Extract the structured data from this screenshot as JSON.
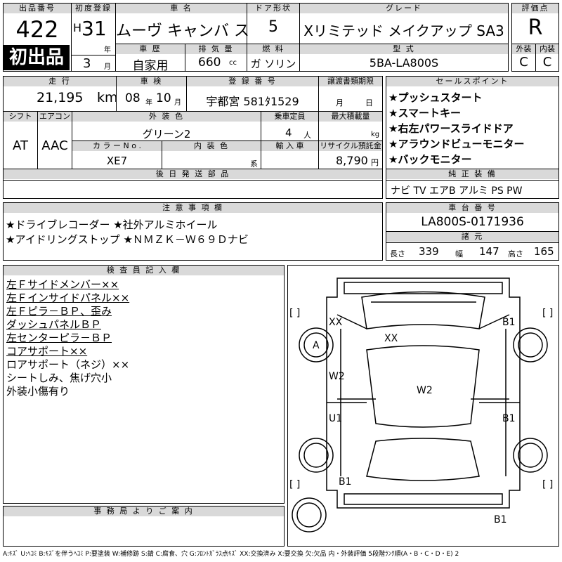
{
  "header": {
    "lot_label": "出品番号",
    "lot_no": "422",
    "first_badge": "初出品",
    "reg_label": "初度登録",
    "era": "H",
    "year": "31",
    "year_unit": "年",
    "month": "3",
    "month_unit": "月",
    "name_label": "車 名",
    "car_name": "ムーヴ キャンバ ス",
    "door_label": "ドア形状",
    "doors": "5",
    "grade_label": "グレード",
    "grade": "Xリミテッド メイクアップ  SA3",
    "score_label": "評価点",
    "score": "R",
    "history_label": "車 歴",
    "history": "自家用",
    "disp_label": "排 気 量",
    "disp": "660",
    "disp_unit": "cc",
    "fuel_label": "燃 料",
    "fuel": "ガ ソリン",
    "model_label": "型 式",
    "model": "5BA-LA800S",
    "ext_label": "外装",
    "ext": "C",
    "int_label": "内装",
    "int": "C"
  },
  "row2": {
    "mileage_label": "走 行",
    "mileage": "21,195",
    "mileage_unit": "km",
    "inspection_label": "車 検",
    "insp_year": "08",
    "insp_year_unit": "年",
    "insp_month": "10",
    "insp_month_unit": "月",
    "plate_label": "登 録 番 号",
    "plate": "宇都宮 581ﾀ1529",
    "transfer_label": "譲渡書類期限",
    "transfer_month": "月",
    "transfer_day": "日",
    "shift_label": "シフト",
    "shift": "AT",
    "ac_label": "エアコン",
    "ac": "AAC",
    "color_label": "外 装 色",
    "color": "グリーン2",
    "capacity_label": "乗車定員",
    "capacity": "4",
    "capacity_unit": "人",
    "load_label": "最大積載量",
    "load_unit": "kg",
    "color_no_label": "カ ラ ー N o .",
    "color_no": "XE7",
    "int_color_label": "内 装 色",
    "int_color_unit": "系",
    "import_label": "輸 入 車",
    "recycle_label": "リサイクル預託金",
    "recycle": "8,790",
    "recycle_unit": "円",
    "later_label": "後 日 発 送 部 品"
  },
  "sales": {
    "label": "セールスポイント",
    "points": [
      "★プッシュスタート",
      "★スマートキー",
      "★右左パワースライドドア",
      "★アラウンドビューモニター",
      "★バックモニター"
    ]
  },
  "equipment": {
    "label": "純 正 装 備",
    "value": "ナビ  TV  エアB  アルミ  PS  PW"
  },
  "caution": {
    "label": "注 意 事 項 欄",
    "lines": [
      "★ドライブレコーダー  ★社外アルミホイール",
      "★アイドリングストップ  ★ＮＭＺＫ－Ｗ６９Ｄナビ"
    ]
  },
  "chassis": {
    "label": "車 台 番 号",
    "value": "LA800S-0171936",
    "spec_label": "諸 元",
    "length_label": "長さ",
    "length": "339",
    "width_label": "幅",
    "width": "147",
    "height_label": "高さ",
    "height": "165"
  },
  "inspector": {
    "label": "検 査 員 記 入 欄",
    "lines": [
      "左Ｆサイドメンバー××",
      "左Ｆインサイドパネル××",
      "左Ｆピラ－ＢＰ、歪み",
      "ダッシュパネルＢＰ",
      "左センターピラ－ＢＰ",
      "コアサポート××",
      "ロアサポート（ネジ）××",
      "シートしみ、焦げ穴小",
      "外装小傷有り"
    ]
  },
  "office": {
    "label": "事 務 局 よ り ご 案 内"
  },
  "diagram": {
    "marks": {
      "front_left": "XX",
      "hood": "XX",
      "front_right": "B1",
      "front_left_wheel": "A",
      "left_front_door": "W2",
      "roof": "W2",
      "left_rear_door": "U1",
      "right_rear_door": "B1",
      "rear_left": "B1",
      "rear_right": "B1",
      "bracket": "[ ]"
    }
  },
  "legend": "A:ｷｽﾞ  U:ﾍｺﾐ  B:ｷｽﾞを伴うﾍｺﾐ  P:要塗装  W:補修跡  S:錆  C:腐食、穴  G:ﾌﾛﾝﾄｶﾞﾗｽ点ｷｽﾞ  XX:交換済み  X:要交換  欠:欠品  内・外装評価 5段階ﾗﾝｸ順(A・B・C・D・E)  2"
}
